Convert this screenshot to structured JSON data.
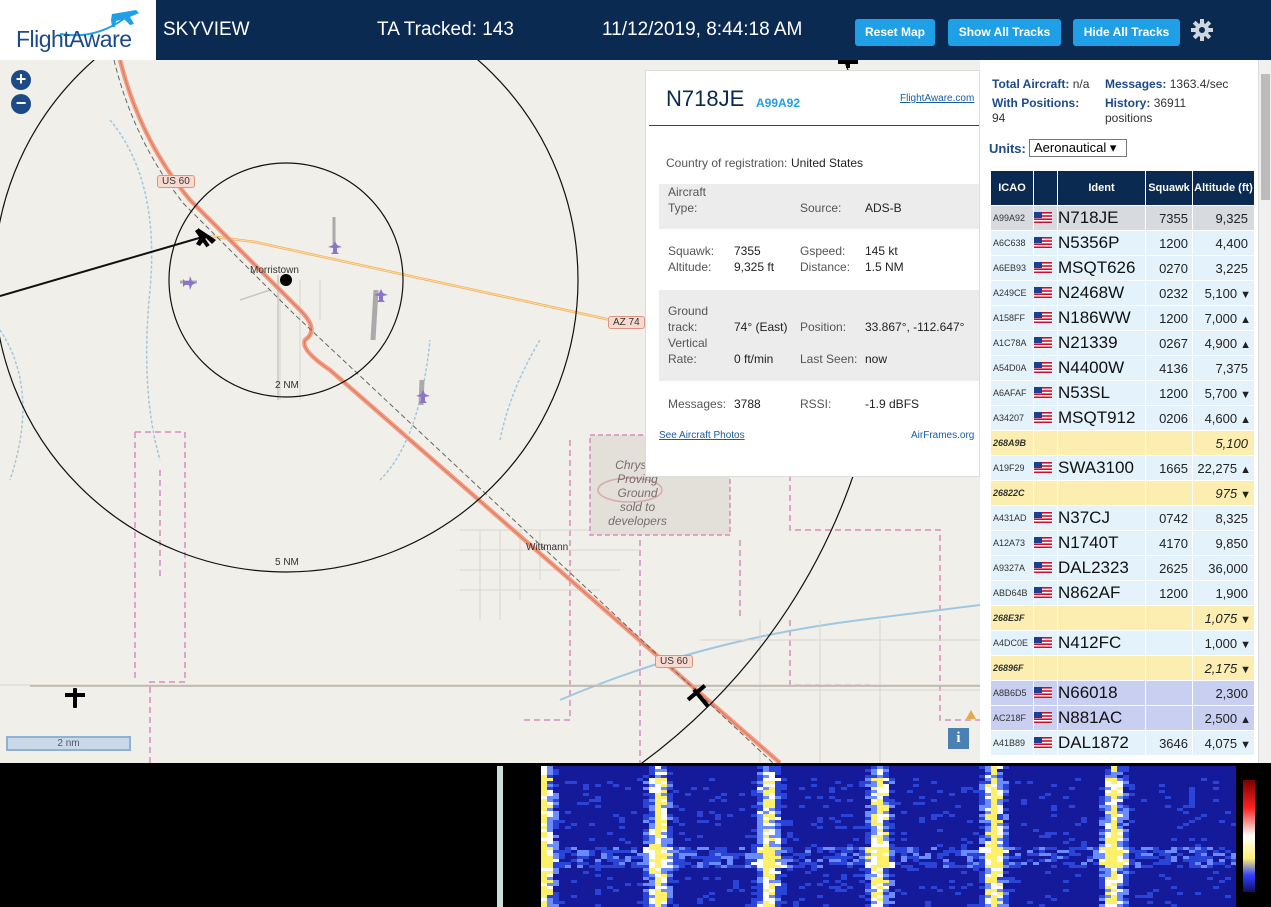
{
  "header": {
    "logo_text": "FlightAware",
    "app_name": "SKYVIEW",
    "tracked": "TA Tracked: 143",
    "datetime": "11/12/2019, 8:44:18 AM",
    "buttons": {
      "reset": "Reset Map",
      "show": "Show All Tracks",
      "hide": "Hide All Tracks"
    },
    "settings_icon": "gear-icon"
  },
  "map": {
    "zoom_in": "+",
    "zoom_out": "−",
    "ring_labels": [
      "2 NM",
      "5 NM"
    ],
    "places": [
      "Morristown",
      "Wittmann"
    ],
    "proving_ground": [
      "Chrysler",
      "Proving",
      "Ground",
      "sold to",
      "developers"
    ],
    "road_signs": [
      "US 60",
      "AZ 74",
      "US 60"
    ],
    "scale_label": "2 nm",
    "info_label": "i"
  },
  "popup": {
    "registration": "N718JE",
    "hex": "A99A92",
    "fa_link": "FlightAware.com",
    "country_label": "Country of registration:",
    "country_value": "United States",
    "aircraft_type_label": "Aircraft",
    "aircraft_type_label2": "Type:",
    "source_label": "Source:",
    "source_value": "ADS-B",
    "squawk_label": "Squawk:",
    "squawk_value": "7355",
    "altitude_label": "Altitude:",
    "altitude_value": "9,325 ft",
    "gspeed_label": "Gspeed:",
    "gspeed_value": "145 kt",
    "distance_label": "Distance:",
    "distance_value": "1.5 NM",
    "track_label1": "Ground",
    "track_label2": "track:",
    "track_value": "74° (East)",
    "position_label": "Position:",
    "position_value": "33.867°, -112.647°",
    "vrate_label1": "Vertical",
    "vrate_label2": "Rate:",
    "vrate_value": "0 ft/min",
    "lastseen_label": "Last Seen:",
    "lastseen_value": "now",
    "messages_label": "Messages:",
    "messages_value": "3788",
    "rssi_label": "RSSI:",
    "rssi_value": "-1.9 dBFS",
    "photos_link": "See Aircraft Photos",
    "airframes_link": "AirFrames.org"
  },
  "sidebar": {
    "total_label": "Total Aircraft:",
    "total_value": "n/a",
    "messages_label": "Messages:",
    "messages_value": "1363.4/sec",
    "positions_label": "With Positions:",
    "positions_value": "94",
    "history_label": "History:",
    "history_value": "36911",
    "history_unit": "positions",
    "units_label": "Units:",
    "units_value": "Aeronautical ▾",
    "columns": [
      "ICAO",
      "",
      "Ident",
      "Squawk",
      "Altitude (ft)"
    ],
    "rows": [
      {
        "icao": "A99A92",
        "flag": true,
        "ident": "N718JE",
        "squawk": "7355",
        "alt": "9,325",
        "trend": "",
        "type": "selected"
      },
      {
        "icao": "A6C638",
        "flag": true,
        "ident": "N5356P",
        "squawk": "1200",
        "alt": "4,400",
        "trend": "",
        "type": "normal"
      },
      {
        "icao": "A6EB93",
        "flag": true,
        "ident": "MSQT626",
        "squawk": "0270",
        "alt": "3,225",
        "trend": "",
        "type": "normal"
      },
      {
        "icao": "A249CE",
        "flag": true,
        "ident": "N2468W",
        "squawk": "0232",
        "alt": "5,100",
        "trend": "▼",
        "type": "normal"
      },
      {
        "icao": "A158FF",
        "flag": true,
        "ident": "N186WW",
        "squawk": "1200",
        "alt": "7,000",
        "trend": "▲",
        "type": "normal"
      },
      {
        "icao": "A1C78A",
        "flag": true,
        "ident": "N21339",
        "squawk": "0267",
        "alt": "4,900",
        "trend": "▲",
        "type": "normal"
      },
      {
        "icao": "A54D0A",
        "flag": true,
        "ident": "N4400W",
        "squawk": "4136",
        "alt": "7,375",
        "trend": "",
        "type": "normal"
      },
      {
        "icao": "A6AFAF",
        "flag": true,
        "ident": "N53SL",
        "squawk": "1200",
        "alt": "5,700",
        "trend": "▼",
        "type": "normal"
      },
      {
        "icao": "A34207",
        "flag": true,
        "ident": "MSQT912",
        "squawk": "0206",
        "alt": "4,600",
        "trend": "▲",
        "type": "normal"
      },
      {
        "icao": "268A9B",
        "flag": false,
        "ident": "",
        "squawk": "",
        "alt": "5,100",
        "trend": "",
        "type": "mlat"
      },
      {
        "icao": "A19F29",
        "flag": true,
        "ident": "SWA3100",
        "squawk": "1665",
        "alt": "22,275",
        "trend": "▲",
        "type": "normal"
      },
      {
        "icao": "26822C",
        "flag": false,
        "ident": "",
        "squawk": "",
        "alt": "975",
        "trend": "▼",
        "type": "mlat"
      },
      {
        "icao": "A431AD",
        "flag": true,
        "ident": "N37CJ",
        "squawk": "0742",
        "alt": "8,325",
        "trend": "",
        "type": "normal"
      },
      {
        "icao": "A12A73",
        "flag": true,
        "ident": "N1740T",
        "squawk": "4170",
        "alt": "9,850",
        "trend": "",
        "type": "normal"
      },
      {
        "icao": "A9327A",
        "flag": true,
        "ident": "DAL2323",
        "squawk": "2625",
        "alt": "36,000",
        "trend": "",
        "type": "normal"
      },
      {
        "icao": "ABD64B",
        "flag": true,
        "ident": "N862AF",
        "squawk": "1200",
        "alt": "1,900",
        "trend": "",
        "type": "normal"
      },
      {
        "icao": "268E3F",
        "flag": false,
        "ident": "",
        "squawk": "",
        "alt": "1,075",
        "trend": "▼",
        "type": "mlat"
      },
      {
        "icao": "A4DC0E",
        "flag": true,
        "ident": "N412FC",
        "squawk": "",
        "alt": "1,000",
        "trend": "▼",
        "type": "normal"
      },
      {
        "icao": "26896F",
        "flag": false,
        "ident": "",
        "squawk": "",
        "alt": "2,175",
        "trend": "▼",
        "type": "mlat"
      },
      {
        "icao": "A8B6D5",
        "flag": true,
        "ident": "N66018",
        "squawk": "",
        "alt": "2,300",
        "trend": "",
        "type": "tisb"
      },
      {
        "icao": "AC218F",
        "flag": true,
        "ident": "N881AC",
        "squawk": "",
        "alt": "2,500",
        "trend": "▲",
        "type": "tisb"
      },
      {
        "icao": "A41B89",
        "flag": true,
        "ident": "DAL1872",
        "squawk": "3646",
        "alt": "4,075",
        "trend": "▼",
        "type": "normal"
      }
    ]
  },
  "colors": {
    "header_bg": "#0b2a52",
    "button_bg": "#1e9fe6",
    "row_normal": "#e3f2fb",
    "row_mlat": "#fbeeb0",
    "row_tisb": "#c8cff0",
    "track_line": "#f0b060",
    "highway": "#f19c83"
  }
}
